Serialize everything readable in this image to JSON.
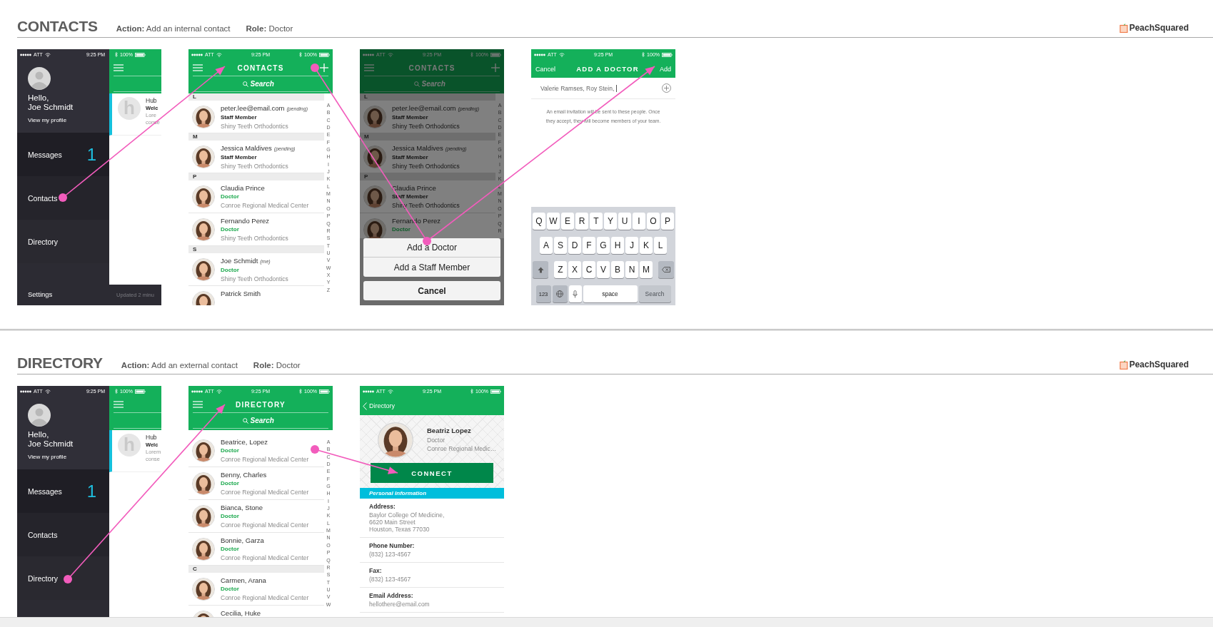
{
  "sections": [
    {
      "title": "CONTACTS",
      "action": "**Action:** Add an internal contact",
      "role": "**Role:** Doctor",
      "brand": "PeachSquared",
      "screens": [
        {
          "kind": "drawer",
          "status": {
            "carrier": "ATT",
            "time": "9:25 PM",
            "battery": "100%"
          },
          "greeting": "Hello,",
          "user": "Joe Schmidt",
          "profile_link": "View my profile",
          "menu": [
            {
              "label": "Messages",
              "badge": "1"
            },
            {
              "label": "Contacts"
            },
            {
              "label": "Directory"
            },
            {
              "label": "Settings"
            }
          ],
          "card": {
            "avatar_letter": "h",
            "title": "Hub",
            "subtitle": "Welc",
            "preview": [
              "Lore",
              "conse"
            ]
          },
          "footer": "Updated 2 minu"
        },
        {
          "kind": "list",
          "dimmed": false,
          "status": {
            "carrier": "ATT",
            "time": "9:25 PM",
            "battery": "100%"
          },
          "title": "CONTACTS",
          "add_button": true,
          "search_placeholder": "Search",
          "index": [
            "A",
            "B",
            "C",
            "D",
            "E",
            "F",
            "G",
            "H",
            "I",
            "J",
            "K",
            "L",
            "M",
            "N",
            "O",
            "P",
            "Q",
            "R",
            "S",
            "T",
            "U",
            "V",
            "W",
            "X",
            "Y",
            "Z"
          ],
          "entries": [
            {
              "kind": "header",
              "label": "L"
            },
            {
              "kind": "contact",
              "name": "peter.lee@email.com",
              "note": "(pending)",
              "role": "Staff Member",
              "color": "#222222",
              "org": "Shiny Teeth Orthodontics"
            },
            {
              "kind": "header",
              "label": "M"
            },
            {
              "kind": "contact",
              "name": "Jessica Maldives",
              "note": "(pending)",
              "role": "Staff Member",
              "color": "#222222",
              "org": "Shiny Teeth Orthodontics"
            },
            {
              "kind": "header",
              "label": "P"
            },
            {
              "kind": "contact",
              "name": "Claudia Prince",
              "role": "Doctor",
              "color": "#1aa84c",
              "org": "Conroe Regional Medical Center"
            },
            {
              "kind": "contact",
              "name": "Fernando Perez",
              "role": "Doctor",
              "color": "#1aa84c",
              "org": "Shiny Teeth Orthodontics"
            },
            {
              "kind": "header",
              "label": "S"
            },
            {
              "kind": "contact",
              "name": "Joe Schmidt",
              "note": "(me)",
              "role": "Doctor",
              "color": "#1aa84c",
              "org": "Shiny Teeth Orthodontics"
            },
            {
              "kind": "contact",
              "name": "Patrick Smith"
            }
          ]
        },
        {
          "kind": "list",
          "dimmed": true,
          "status": {
            "carrier": "ATT",
            "time": "9:25 PM",
            "battery": "100%"
          },
          "title": "CONTACTS",
          "add_button": true,
          "search_placeholder": "Search",
          "index": [
            "A",
            "B",
            "C",
            "D",
            "E",
            "F",
            "G",
            "H",
            "I",
            "J",
            "K",
            "L",
            "M",
            "N",
            "O",
            "P",
            "Q",
            "R"
          ],
          "entries": [
            {
              "kind": "header",
              "label": "L"
            },
            {
              "kind": "contact",
              "name": "peter.lee@email.com",
              "note": "(pending)",
              "role": "Staff Member",
              "color": "#111111",
              "org": "Shiny Teeth Orthodontics"
            },
            {
              "kind": "header",
              "label": "M"
            },
            {
              "kind": "contact",
              "name": "Jessica Maldives",
              "note": "(pending)",
              "role": "Staff Member",
              "color": "#111111",
              "org": "Shiny Teeth Orthodontics"
            },
            {
              "kind": "header",
              "label": "P"
            },
            {
              "kind": "contact",
              "name": "Claudia Prince",
              "role": "Staff Member",
              "color": "#111111",
              "org": "Shiny Teeth Orthodontics"
            },
            {
              "kind": "contact",
              "name": "Fernando Perez",
              "role": "Doctor",
              "color": "#0c5a27"
            }
          ],
          "sheet": {
            "options": [
              "Add a Doctor",
              "Add a Staff Member"
            ],
            "cancel": "Cancel"
          }
        },
        {
          "kind": "form",
          "status": {
            "carrier": "ATT",
            "time": "9:25 PM",
            "battery": "100%"
          },
          "cancel": "Cancel",
          "title": "ADD A DOCTOR",
          "confirm": "Add",
          "recipients": "Valerie Ramses, Roy Stein,",
          "note": "An email invitation will be sent to these people. Once they accept, they will become members of your team.",
          "keyboard": {
            "rows": [
              [
                "Q",
                "W",
                "E",
                "R",
                "T",
                "Y",
                "U",
                "I",
                "O",
                "P"
              ],
              [
                "A",
                "S",
                "D",
                "F",
                "G",
                "H",
                "J",
                "K",
                "L"
              ],
              [
                "Z",
                "X",
                "C",
                "V",
                "B",
                "N",
                "M"
              ]
            ],
            "numbers": "123",
            "space": "space",
            "action": "Search",
            "action_disabled": true
          }
        }
      ]
    },
    {
      "title": "DIRECTORY",
      "action": "**Action:** Add an external contact",
      "role": "**Role:** Doctor",
      "brand": "PeachSquared",
      "screens": [
        {
          "kind": "drawer",
          "status": {
            "carrier": "ATT",
            "time": "9:25 PM",
            "battery": "100%"
          },
          "greeting": "Hello,",
          "user": "Joe Schmidt",
          "profile_link": "View my profile",
          "menu": [
            {
              "label": "Messages",
              "badge": "1"
            },
            {
              "label": "Contacts"
            },
            {
              "label": "Directory"
            }
          ],
          "card": {
            "avatar_letter": "h",
            "title": "Hub",
            "subtitle": "Welc",
            "preview": [
              "Lorem",
              "conse"
            ]
          }
        },
        {
          "kind": "list",
          "dimmed": false,
          "status": {
            "carrier": "ATT",
            "time": "9:25 PM",
            "battery": "100%"
          },
          "title": "DIRECTORY",
          "add_button": false,
          "search_placeholder": "Search",
          "index": [
            "A",
            "B",
            "C",
            "D",
            "E",
            "F",
            "G",
            "H",
            "I",
            "J",
            "K",
            "L",
            "M",
            "N",
            "O",
            "P",
            "Q",
            "R",
            "S",
            "T",
            "U",
            "V",
            "W"
          ],
          "entries": [
            {
              "kind": "contact",
              "name": "Beatrice, Lopez",
              "role": "Doctor",
              "color": "#1aa84c",
              "org": "Conroe Regional Medical Center"
            },
            {
              "kind": "contact",
              "name": "Benny, Charles",
              "role": "Doctor",
              "color": "#1aa84c",
              "org": "Conroe Regional Medical Center"
            },
            {
              "kind": "contact",
              "name": "Bianca, Stone",
              "role": "Doctor",
              "color": "#1aa84c",
              "org": "Conroe Regional Medical Center"
            },
            {
              "kind": "contact",
              "name": "Bonnie, Garza",
              "role": "Doctor",
              "color": "#1aa84c",
              "org": "Conroe Regional Medical Center"
            },
            {
              "kind": "header",
              "label": "C"
            },
            {
              "kind": "contact",
              "name": "Carmen, Arana",
              "role": "Doctor",
              "color": "#1aa84c",
              "org": "Conroe Regional Medical Center"
            },
            {
              "kind": "contact",
              "name": "Cecilia, Huke"
            }
          ]
        },
        {
          "kind": "profile",
          "status": {
            "carrier": "ATT",
            "time": "9:25 PM",
            "battery": "100%"
          },
          "back": "Directory",
          "name": "Beatriz Lopez",
          "role": "Doctor",
          "org": "Conroe Regional Medic…",
          "connect": "CONNECT",
          "info_title": "Personal Information",
          "fields": [
            {
              "label": "Address:",
              "lines": [
                "Baylor College Of Medicine,",
                "6620 Main Street",
                "Houston, Texas 77030"
              ]
            },
            {
              "label": "Phone Number:",
              "lines": [
                "(832) 123-4567"
              ]
            },
            {
              "label": "Fax:",
              "lines": [
                "(832) 123-4567"
              ]
            },
            {
              "label": "Email Address:",
              "lines": [
                "hellothere@email.com"
              ]
            }
          ]
        }
      ]
    }
  ]
}
